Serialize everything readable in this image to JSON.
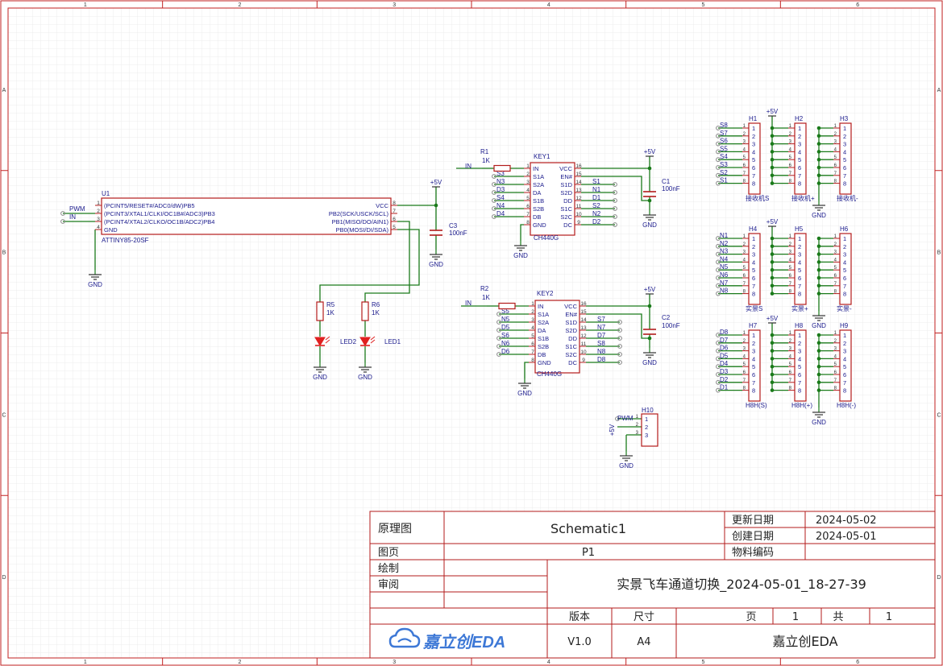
{
  "border": {
    "columns": [
      "1",
      "2",
      "3",
      "4",
      "5",
      "6"
    ],
    "rows": [
      "A",
      "B",
      "C",
      "D"
    ]
  },
  "colors": {
    "wire": "#1a7a1a",
    "part": "#b31b1b",
    "text": "#1a1a8c",
    "net": "#222222",
    "grid": "#e6e6e6",
    "frame": "#c22222",
    "led": "#e02020"
  },
  "u1": {
    "ref": "U1",
    "value": "ATTINY85-20SF",
    "left_pins": [
      {
        "num": "1",
        "name": "(PCINT5/RESET#/ADC0/dW)PB5"
      },
      {
        "num": "2",
        "name": "(PCINT3/XTAL1/CLKI/OC1B#/ADC3)PB3"
      },
      {
        "num": "3",
        "name": "(PCINT4/XTAL2/CLKO/OC1B/ADC2)PB4"
      },
      {
        "num": "4",
        "name": "GND"
      }
    ],
    "right_pins": [
      {
        "num": "8",
        "name": "VCC"
      },
      {
        "num": "7",
        "name": "PB2(SCK/USCK/SCL)"
      },
      {
        "num": "6",
        "name": "PB1(MISO/DO/AIN1)"
      },
      {
        "num": "5",
        "name": "PB0(MOSI/DI/SDA)"
      }
    ],
    "net_pwm": "PWM",
    "net_in": "IN"
  },
  "power": {
    "vcc": "+5V",
    "gnd": "GND"
  },
  "c3": {
    "ref": "C3",
    "value": "100nF"
  },
  "r5": {
    "ref": "R5",
    "value": "1K"
  },
  "r6": {
    "ref": "R6",
    "value": "1K"
  },
  "led2": {
    "ref": "LED2"
  },
  "led1": {
    "ref": "LED1"
  },
  "r1": {
    "ref": "R1",
    "value": "1K",
    "net": "IN"
  },
  "r2": {
    "ref": "R2",
    "value": "1K",
    "net": "IN"
  },
  "c1": {
    "ref": "C1",
    "value": "100nF"
  },
  "c2": {
    "ref": "C2",
    "value": "100nF"
  },
  "key1": {
    "ref": "KEY1",
    "value": "CH440G",
    "left_pins": [
      {
        "num": "1",
        "name": "IN",
        "net": ""
      },
      {
        "num": "2",
        "name": "S1A",
        "net": "S3"
      },
      {
        "num": "3",
        "name": "S2A",
        "net": "N3"
      },
      {
        "num": "4",
        "name": "DA",
        "net": "D3"
      },
      {
        "num": "5",
        "name": "S1B",
        "net": "S4"
      },
      {
        "num": "6",
        "name": "S2B",
        "net": "N4"
      },
      {
        "num": "7",
        "name": "DB",
        "net": "D4"
      },
      {
        "num": "8",
        "name": "GND",
        "net": ""
      }
    ],
    "right_pins": [
      {
        "num": "16",
        "name": "VCC",
        "net": ""
      },
      {
        "num": "15",
        "name": "EN#",
        "net": ""
      },
      {
        "num": "14",
        "name": "S1D",
        "net": "S1"
      },
      {
        "num": "13",
        "name": "S2D",
        "net": "N1"
      },
      {
        "num": "12",
        "name": "DD",
        "net": "D1"
      },
      {
        "num": "11",
        "name": "S1C",
        "net": "S2"
      },
      {
        "num": "10",
        "name": "S2C",
        "net": "N2"
      },
      {
        "num": "9",
        "name": "DC",
        "net": "D2"
      }
    ]
  },
  "key2": {
    "ref": "KEY2",
    "value": "CH440G",
    "left_pins": [
      {
        "num": "1",
        "name": "IN",
        "net": ""
      },
      {
        "num": "2",
        "name": "S1A",
        "net": "S5"
      },
      {
        "num": "3",
        "name": "S2A",
        "net": "N5"
      },
      {
        "num": "4",
        "name": "DA",
        "net": "D5"
      },
      {
        "num": "5",
        "name": "S1B",
        "net": "S6"
      },
      {
        "num": "6",
        "name": "S2B",
        "net": "N6"
      },
      {
        "num": "7",
        "name": "DB",
        "net": "D6"
      },
      {
        "num": "8",
        "name": "GND",
        "net": ""
      }
    ],
    "right_pins": [
      {
        "num": "16",
        "name": "VCC",
        "net": ""
      },
      {
        "num": "15",
        "name": "EN#",
        "net": ""
      },
      {
        "num": "14",
        "name": "S1D",
        "net": "S7"
      },
      {
        "num": "13",
        "name": "S2D",
        "net": "N7"
      },
      {
        "num": "12",
        "name": "DD",
        "net": "D7"
      },
      {
        "num": "11",
        "name": "S1C",
        "net": "S8"
      },
      {
        "num": "10",
        "name": "S2C",
        "net": "N8"
      },
      {
        "num": "9",
        "name": "DC",
        "net": "D8"
      }
    ]
  },
  "headers": [
    {
      "ref": "H1",
      "label": "接收机S",
      "nets": [
        "S8",
        "S7",
        "S6",
        "S5",
        "S4",
        "S3",
        "S2",
        "S1"
      ]
    },
    {
      "ref": "H2",
      "label": "接收机+",
      "nets": []
    },
    {
      "ref": "H3",
      "label": "接收机-",
      "nets": []
    },
    {
      "ref": "H4",
      "label": "实景S",
      "nets": [
        "N1",
        "N2",
        "N3",
        "N4",
        "N5",
        "N6",
        "N7",
        "N8"
      ]
    },
    {
      "ref": "H5",
      "label": "实景+",
      "nets": []
    },
    {
      "ref": "H6",
      "label": "实景-",
      "nets": []
    },
    {
      "ref": "H7",
      "label": "H8H(S)",
      "nets": [
        "D8",
        "D7",
        "D6",
        "D5",
        "D4",
        "D3",
        "D2",
        "D1"
      ]
    },
    {
      "ref": "H8",
      "label": "H8H(+)",
      "nets": []
    },
    {
      "ref": "H9",
      "label": "H8H(-)",
      "nets": []
    }
  ],
  "pin_numbers": [
    "1",
    "2",
    "3",
    "4",
    "5",
    "6",
    "7",
    "8"
  ],
  "h10": {
    "ref": "H10",
    "pins": [
      "1",
      "2",
      "3"
    ],
    "net_pwm": "PWM"
  },
  "title_block": {
    "doc_type_label": "原理图",
    "doc_name": "Schematic1",
    "update_date_label": "更新日期",
    "update_date": "2024-05-02",
    "create_date_label": "创建日期",
    "create_date": "2024-05-01",
    "page_label": "图页",
    "page_value": "P1",
    "material_label": "物料编码",
    "draw_label": "绘制",
    "review_label": "审阅",
    "project_title": "实景飞车通道切换_2024-05-01_18-27-39",
    "version_label": "版本",
    "size_label": "尺寸",
    "page_count_label": "页",
    "page_num": "1",
    "total_label": "共",
    "total_num": "1",
    "logo_text": "嘉立创EDA",
    "version": "V1.0",
    "size": "A4",
    "company": "嘉立创EDA"
  }
}
